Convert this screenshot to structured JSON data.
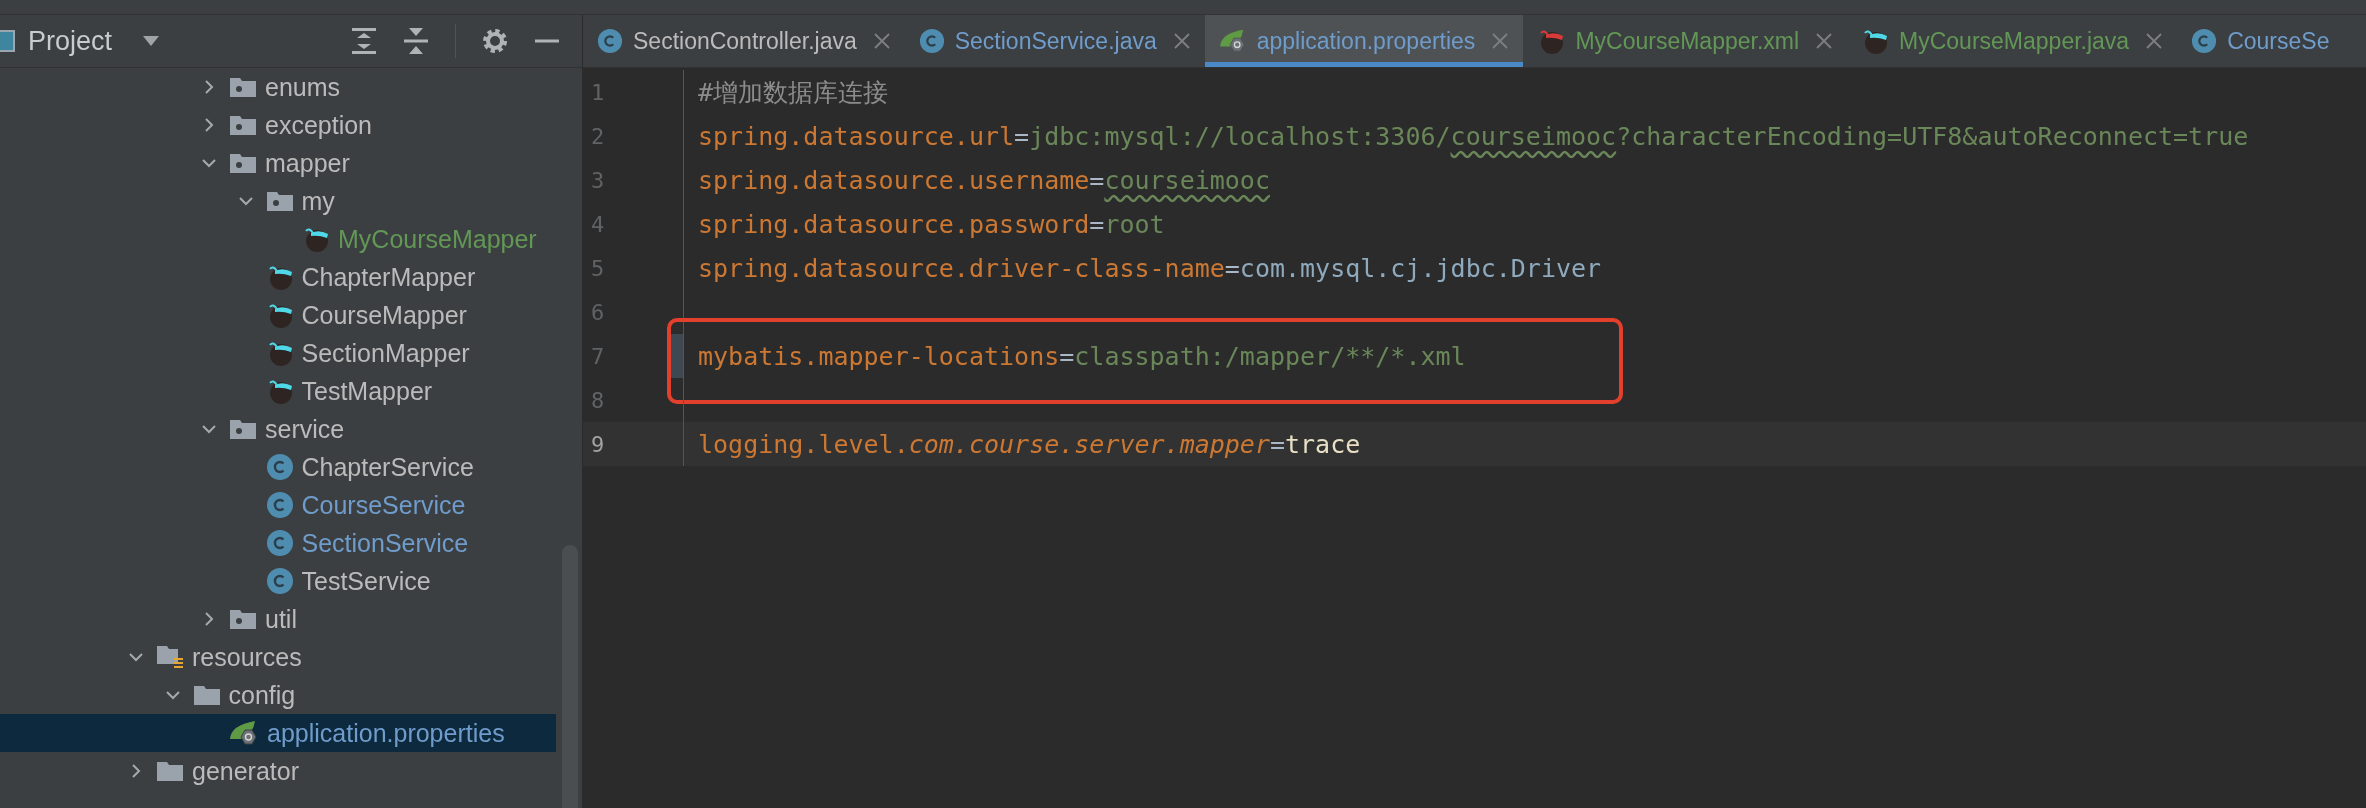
{
  "project_panel": {
    "title": "Project"
  },
  "tree": {
    "partial_branch": [
      {
        "label": "enums",
        "kind": "package",
        "expanded": false,
        "selected": false,
        "color": "#bbbbbb"
      },
      {
        "label": "exception",
        "kind": "package",
        "expanded": false,
        "selected": false,
        "color": "#bbbbbb"
      },
      {
        "label": "mapper",
        "kind": "package",
        "expanded": true,
        "selected": false,
        "color": "#bbbbbb",
        "children": [
          {
            "label": "my",
            "kind": "package",
            "expanded": true,
            "selected": false,
            "color": "#bbbbbb",
            "children": [
              {
                "label": "MyCourseMapper",
                "kind": "mapper",
                "selected": false,
                "color": "#629755"
              }
            ]
          },
          {
            "label": "ChapterMapper",
            "kind": "mapper",
            "selected": false,
            "color": "#bbbbbb"
          },
          {
            "label": "CourseMapper",
            "kind": "mapper",
            "selected": false,
            "color": "#bbbbbb"
          },
          {
            "label": "SectionMapper",
            "kind": "mapper",
            "selected": false,
            "color": "#bbbbbb"
          },
          {
            "label": "TestMapper",
            "kind": "mapper",
            "selected": false,
            "color": "#bbbbbb"
          }
        ]
      },
      {
        "label": "service",
        "kind": "package",
        "expanded": true,
        "selected": false,
        "color": "#bbbbbb",
        "children": [
          {
            "label": "ChapterService",
            "kind": "class",
            "selected": false,
            "color": "#bbbbbb"
          },
          {
            "label": "CourseService",
            "kind": "class",
            "selected": false,
            "color": "#6f9ccb"
          },
          {
            "label": "SectionService",
            "kind": "class",
            "selected": false,
            "color": "#6f9ccb"
          },
          {
            "label": "TestService",
            "kind": "class",
            "selected": false,
            "color": "#bbbbbb"
          }
        ]
      },
      {
        "label": "util",
        "kind": "package",
        "expanded": false,
        "selected": false,
        "color": "#bbbbbb"
      }
    ],
    "items": [
      {
        "label": "resources",
        "kind": "resources",
        "expanded": true,
        "selected": false,
        "color": "#bbbbbb",
        "children": [
          {
            "label": "config",
            "kind": "folder",
            "expanded": true,
            "selected": false,
            "color": "#bbbbbb",
            "children": [
              {
                "label": "application.properties",
                "kind": "properties",
                "selected": true,
                "color": "#6f9ccb"
              }
            ]
          }
        ]
      },
      {
        "label": "generator",
        "kind": "folder",
        "expanded": false,
        "selected": false,
        "color": "#bbbbbb"
      }
    ]
  },
  "tabs": [
    {
      "label": "SectionController.java",
      "kind": "class",
      "color": "#bbbbbb",
      "selected": false,
      "close_button": true
    },
    {
      "label": "SectionService.java",
      "kind": "class",
      "color": "#6f9ccb",
      "selected": false,
      "close_button": true
    },
    {
      "label": "application.properties",
      "kind": "properties",
      "color": "#6f9ccb",
      "selected": true,
      "close_button": true
    },
    {
      "label": "MyCourseMapper.xml",
      "kind": "mapper_xml",
      "color": "#629755",
      "selected": false,
      "close_button": true
    },
    {
      "label": "MyCourseMapper.java",
      "kind": "mapper",
      "color": "#629755",
      "selected": false,
      "close_button": true
    },
    {
      "label": "CourseSe",
      "kind": "class",
      "color": "#6f9ccb",
      "selected": false,
      "close_button": false
    }
  ],
  "editor": {
    "lines": [
      {
        "number": "1",
        "current": false,
        "changed": false,
        "boxed": false,
        "tokens": [
          {
            "kind": "comment",
            "text": "#增加数据库连接"
          }
        ]
      },
      {
        "number": "2",
        "current": false,
        "changed": false,
        "boxed": false,
        "tokens": [
          {
            "kind": "key",
            "text": "spring.datasource.url"
          },
          {
            "kind": "op",
            "text": "="
          },
          {
            "kind": "value",
            "text": "jdbc:mysql://localhost:3306/"
          },
          {
            "kind": "typo",
            "text": "courseimooc"
          },
          {
            "kind": "value",
            "text": "?characterEncoding=UTF8&autoReconnect=true"
          }
        ]
      },
      {
        "number": "3",
        "current": false,
        "changed": false,
        "boxed": false,
        "tokens": [
          {
            "kind": "key",
            "text": "spring.datasource.username"
          },
          {
            "kind": "op",
            "text": "="
          },
          {
            "kind": "typo",
            "text": "courseimooc"
          }
        ]
      },
      {
        "number": "4",
        "current": false,
        "changed": false,
        "boxed": false,
        "tokens": [
          {
            "kind": "key",
            "text": "spring.datasource.password"
          },
          {
            "kind": "op",
            "text": "="
          },
          {
            "kind": "value",
            "text": "root"
          }
        ]
      },
      {
        "number": "5",
        "current": false,
        "changed": false,
        "boxed": false,
        "tokens": [
          {
            "kind": "key",
            "text": "spring.datasource.driver-class-name"
          },
          {
            "kind": "op",
            "text": "="
          },
          {
            "kind": "class",
            "text": "com.mysql.cj.jdbc.Driver"
          }
        ]
      },
      {
        "number": "6",
        "current": false,
        "changed": false,
        "boxed": false
      },
      {
        "number": "7",
        "current": false,
        "changed": true,
        "boxed": true,
        "tokens": [
          {
            "kind": "key",
            "text": "mybatis.mapper-locations"
          },
          {
            "kind": "op",
            "text": "="
          },
          {
            "kind": "value",
            "text": "classpath:/mapper/**/*.xml"
          }
        ]
      },
      {
        "number": "8",
        "current": false,
        "changed": false,
        "boxed": true
      },
      {
        "number": "9",
        "current": true,
        "changed": false,
        "boxed": false,
        "tokens": [
          {
            "kind": "key",
            "text": "logging.level."
          },
          {
            "kind": "key_italic",
            "text": "com.course.server.mapper"
          },
          {
            "kind": "op",
            "text": "="
          },
          {
            "kind": "plain",
            "text": "trace"
          }
        ]
      }
    ]
  }
}
